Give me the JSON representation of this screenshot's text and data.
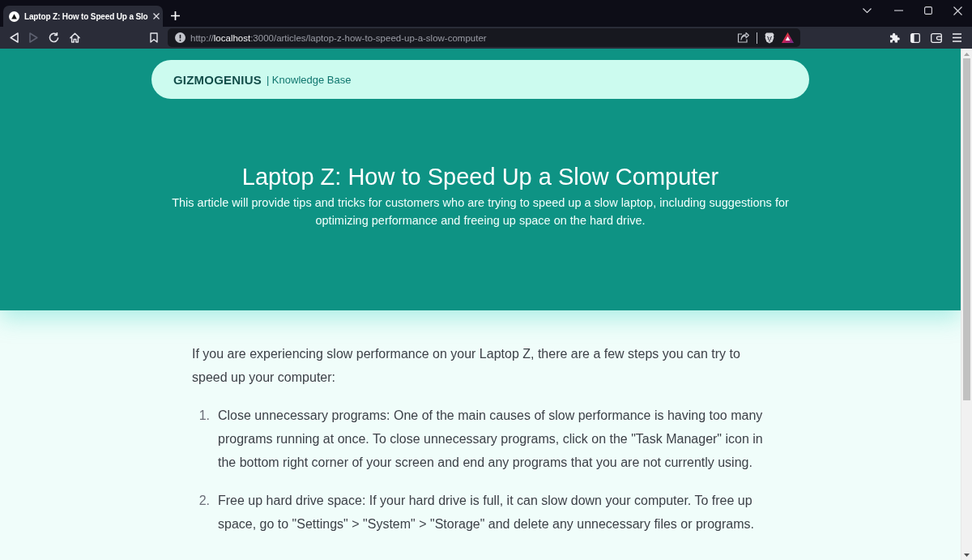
{
  "browser": {
    "tabs": [
      {
        "title": "Laptop Z: How to Speed Up a Slo",
        "selected": true
      }
    ],
    "nav_buttons": [
      {
        "kind": "back",
        "disabled": false
      },
      {
        "kind": "forward",
        "disabled": true
      },
      {
        "kind": "reload",
        "disabled": false
      },
      {
        "kind": "home",
        "disabled": false
      }
    ],
    "address_bar": {
      "url": "http://**localhost**:3000/articles/laptop-z-how-to-speed-up-a-slow-computer"
    }
  },
  "site_header": {
    "brand": "GIZMOGENIUS",
    "section": "| Knowledge Base"
  },
  "hero": {
    "title": "Laptop Z: How to Speed Up a Slow Computer",
    "summary": "This article will provide tips and tricks for customers who are trying to speed up a slow laptop, including suggestions for optimizing performance and freeing up space on the hard drive."
  },
  "article": {
    "intro": "If you are experiencing slow performance on your Laptop Z, there are a few steps you can try to speed up your computer:",
    "steps": [
      {
        "number": "1.",
        "text": "Close unnecessary programs: One of the main causes of slow performance is having too many programs running at once. To close unnecessary programs, click on the \"Task Manager\" icon in the bottom right corner of your screen and end any programs that you are not currently using."
      },
      {
        "number": "2.",
        "text": "Free up hard drive space: If your hard drive is full, it can slow down your computer. To free up space, go to \"Settings\" > \"System\" > \"Storage\" and delete any unnecessary files or programs."
      }
    ]
  }
}
